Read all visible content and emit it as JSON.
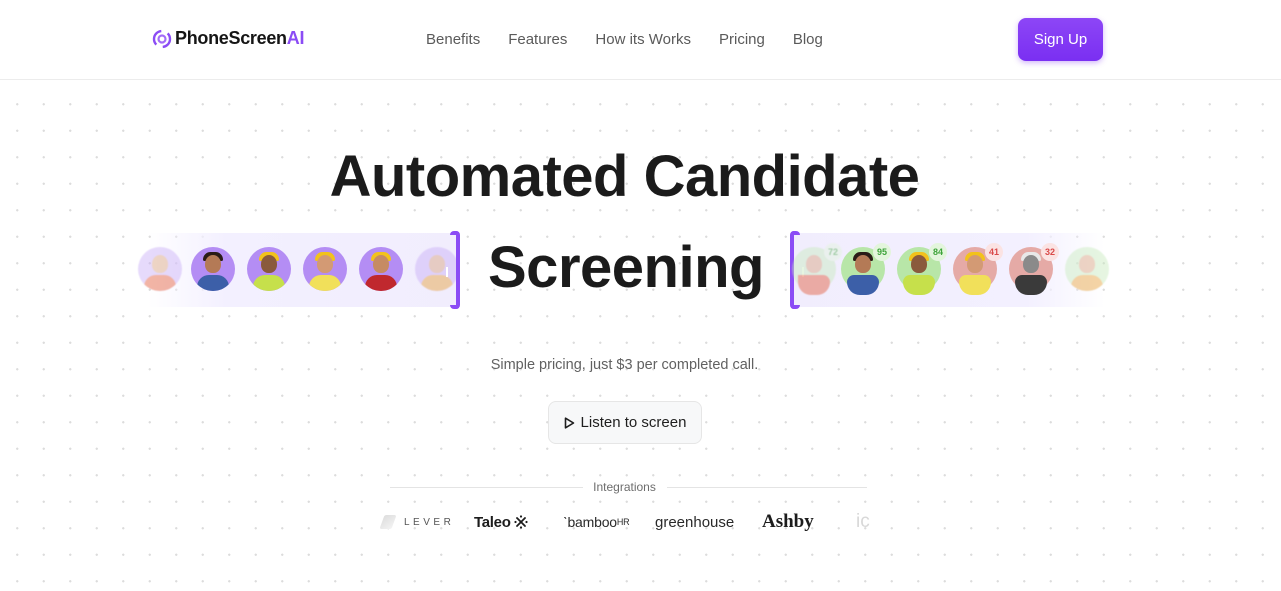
{
  "header": {
    "brand_main": "PhoneScreen",
    "brand_suffix": "AI",
    "nav": [
      {
        "label": "Benefits"
      },
      {
        "label": "Features"
      },
      {
        "label": "How its Works"
      },
      {
        "label": "Pricing"
      },
      {
        "label": "Blog"
      }
    ],
    "signup_label": "Sign Up"
  },
  "colors": {
    "accent": "#8b4cf5",
    "score_good": "#3ea33a",
    "score_bad": "#d94a4a"
  },
  "hero": {
    "headline_line1": "Automated Candidate",
    "headline_line2": "Screening",
    "subtitle": "Simple pricing, just $3 per completed call.",
    "listen_label": "Listen to screen",
    "listen_icon": "play-icon"
  },
  "candidates_incoming": [
    {
      "name": "candidate-1"
    },
    {
      "name": "candidate-2"
    },
    {
      "name": "candidate-3"
    },
    {
      "name": "candidate-4"
    },
    {
      "name": "candidate-5"
    },
    {
      "name": "candidate-6"
    }
  ],
  "candidates_scored": [
    {
      "score": "72",
      "status": "good"
    },
    {
      "score": "95",
      "status": "good"
    },
    {
      "score": "84",
      "status": "good"
    },
    {
      "score": "41",
      "status": "bad"
    },
    {
      "score": "32",
      "status": "bad"
    },
    {
      "score": "",
      "status": "good"
    }
  ],
  "integrations": {
    "label": "Integrations",
    "logos": [
      {
        "name": "LEVER"
      },
      {
        "name": "Taleo"
      },
      {
        "name": "bamboo",
        "suffix": "HR"
      },
      {
        "name": "greenhouse"
      },
      {
        "name": "Ashby"
      },
      {
        "name": "ic"
      }
    ]
  }
}
